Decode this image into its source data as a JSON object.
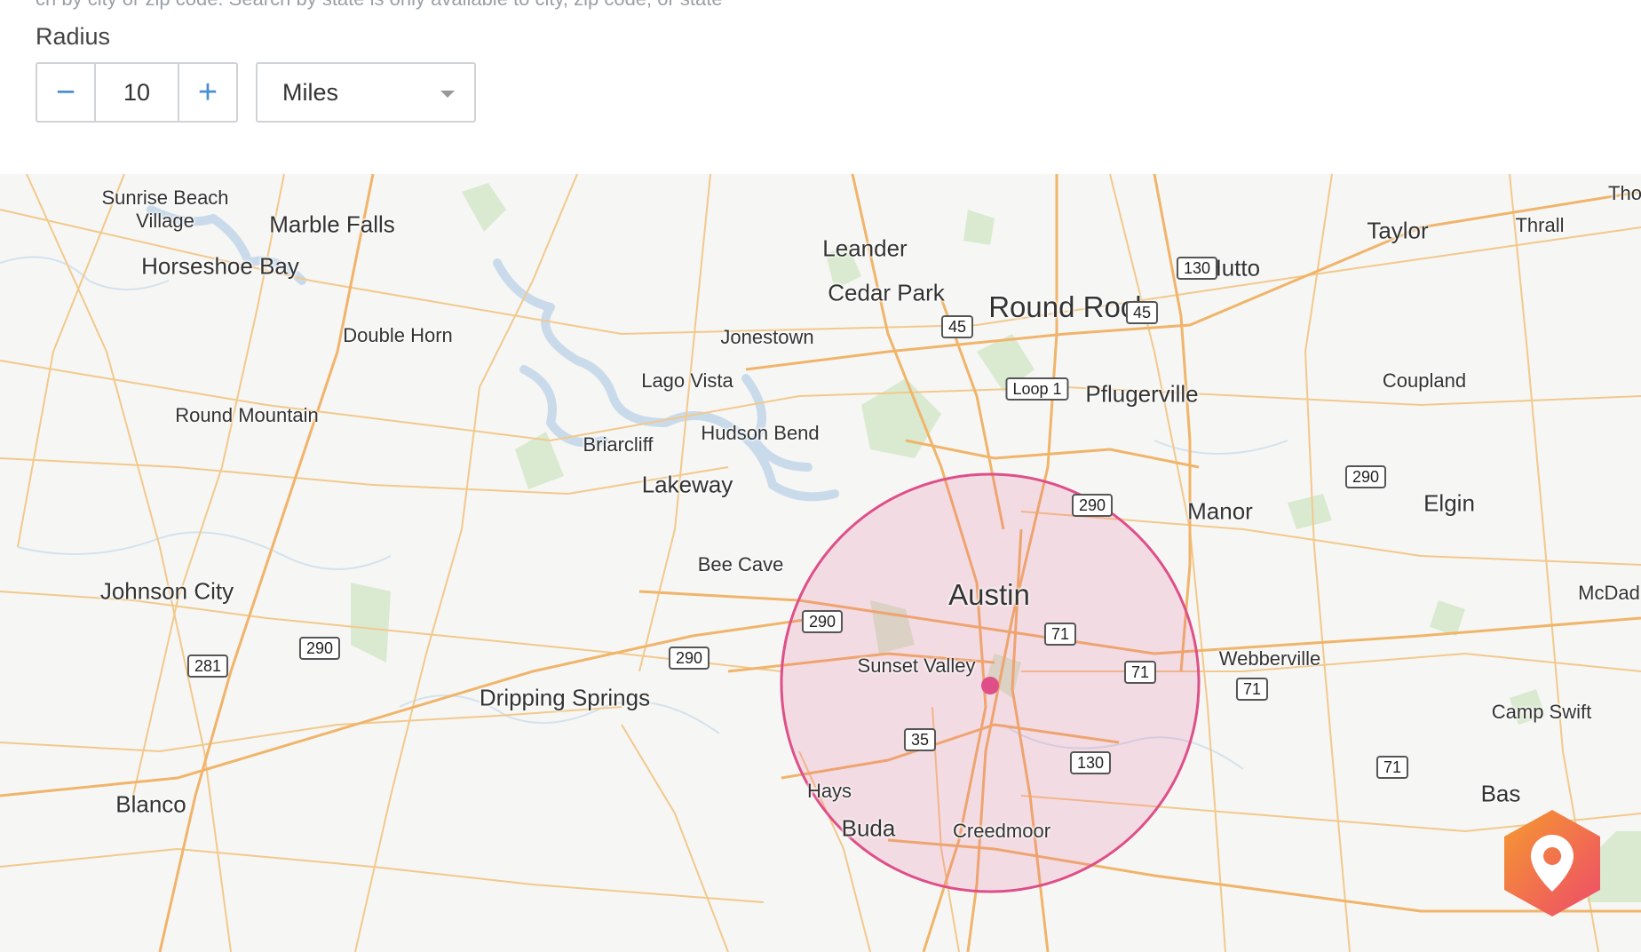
{
  "header": {
    "cut_off_text": "ch by city or zip code. Search by state is only available to city, zip code, or state",
    "radius_label": "Radius"
  },
  "radius": {
    "value": "10",
    "minus_symbol": "−",
    "plus_symbol": "+",
    "unit": "Miles"
  },
  "map": {
    "center_label": "Austin",
    "places": [
      {
        "name": "Sunrise Beach\nVillage",
        "size": "s"
      },
      {
        "name": "Marble Falls",
        "size": "m"
      },
      {
        "name": "Horseshoe Bay",
        "size": "m"
      },
      {
        "name": "Double Horn",
        "size": "s"
      },
      {
        "name": "Round Mountain",
        "size": "s"
      },
      {
        "name": "Johnson City",
        "size": "m"
      },
      {
        "name": "Blanco",
        "size": "m"
      },
      {
        "name": "Leander",
        "size": "m"
      },
      {
        "name": "Cedar Park",
        "size": "m"
      },
      {
        "name": "Round Rock",
        "size": "l"
      },
      {
        "name": "Hutto",
        "size": "m"
      },
      {
        "name": "Taylor",
        "size": "m"
      },
      {
        "name": "Thrall",
        "size": "s"
      },
      {
        "name": "Tho",
        "size": "s"
      },
      {
        "name": "Jonestown",
        "size": "s"
      },
      {
        "name": "Lago Vista",
        "size": "s"
      },
      {
        "name": "Pflugerville",
        "size": "m"
      },
      {
        "name": "Coupland",
        "size": "s"
      },
      {
        "name": "Briarcliff",
        "size": "s"
      },
      {
        "name": "Hudson Bend",
        "size": "s"
      },
      {
        "name": "Lakeway",
        "size": "m"
      },
      {
        "name": "Manor",
        "size": "m"
      },
      {
        "name": "Elgin",
        "size": "m"
      },
      {
        "name": "Bee Cave",
        "size": "s"
      },
      {
        "name": "McDad",
        "size": "s"
      },
      {
        "name": "Sunset Valley",
        "size": "s"
      },
      {
        "name": "Webberville",
        "size": "s"
      },
      {
        "name": "Dripping Springs",
        "size": "m"
      },
      {
        "name": "Camp Swift",
        "size": "s"
      },
      {
        "name": "Hays",
        "size": "s"
      },
      {
        "name": "Buda",
        "size": "m"
      },
      {
        "name": "Creedmoor",
        "size": "s"
      },
      {
        "name": "Bas",
        "size": "m"
      }
    ],
    "shields": [
      "130",
      "45",
      "45",
      "Loop 1",
      "290",
      "290",
      "290",
      "71",
      "71",
      "71",
      "290",
      "281",
      "290",
      "35",
      "130",
      "71"
    ]
  }
}
